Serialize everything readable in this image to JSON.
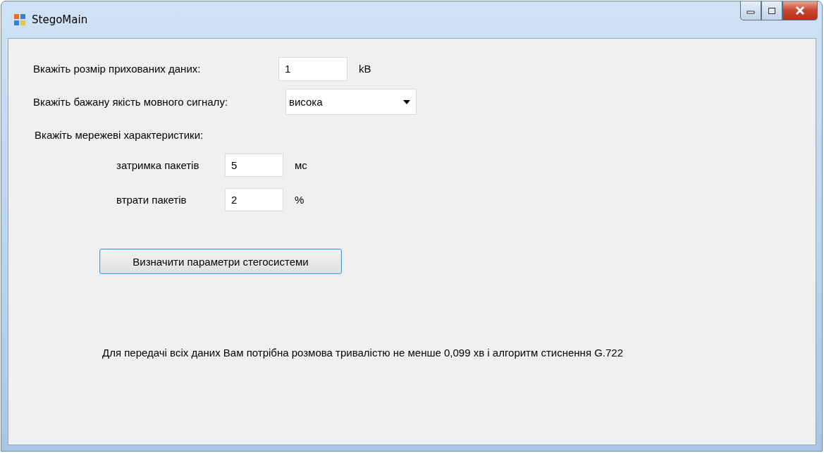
{
  "window": {
    "title": "StegoMain",
    "controls": [
      {
        "kind": "minimize"
      },
      {
        "kind": "maximize"
      },
      {
        "kind": "close"
      }
    ]
  },
  "form": {
    "rows": [
      {
        "kind": "text",
        "label": "Вкажіть розмір прихованих даних:",
        "value": "1",
        "unit": "kB"
      },
      {
        "kind": "combo",
        "label": "Вкажіть бажану якість мовного сигналу:",
        "value": "висока"
      }
    ],
    "network_heading": "Вкажіть мережеві характеристики:",
    "network_rows": [
      {
        "label": "затримка пакетів",
        "value": "5",
        "unit": "мс"
      },
      {
        "label": "втрати пакетів",
        "value": "2",
        "unit": "%"
      }
    ],
    "button": "Визначити параметри стегосистеми",
    "result": "Для передачі всіх даних Вам потрібна розмова тривалістю не менше 0,099 хв і алгоритм стиснення G.722"
  }
}
